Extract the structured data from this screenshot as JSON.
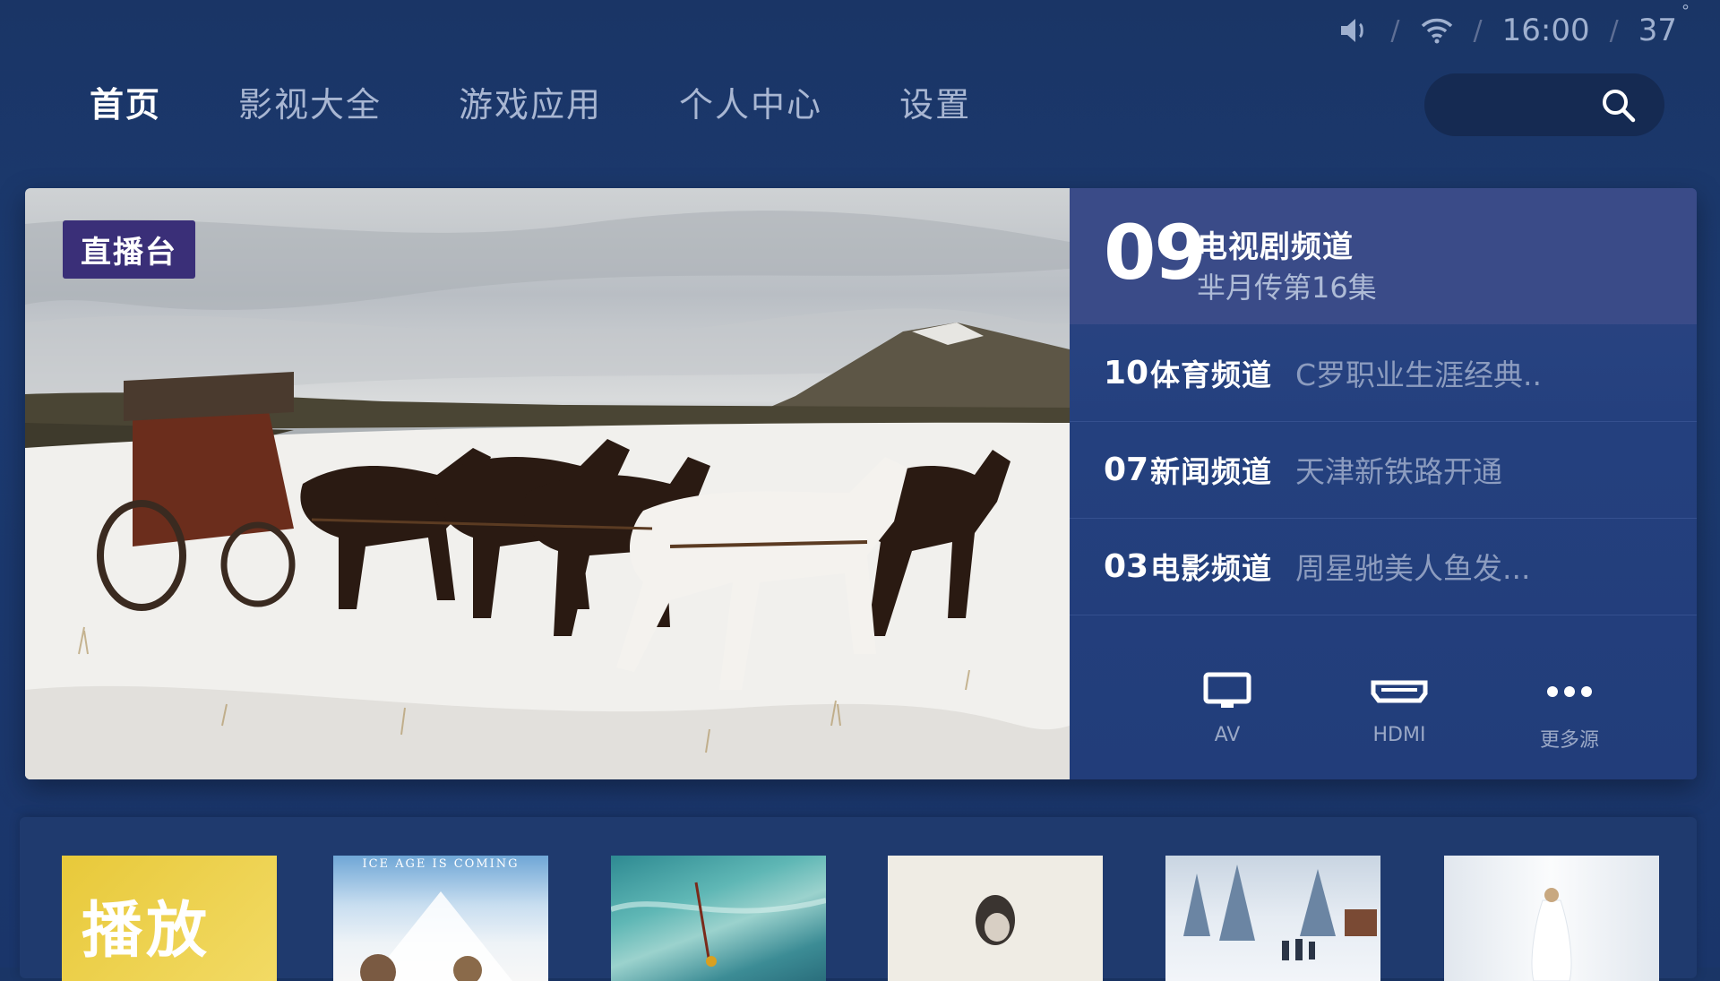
{
  "status": {
    "volume_icon": "speaker-icon",
    "wifi_icon": "wifi-icon",
    "time": "16:00",
    "temperature": "37",
    "temp_unit": "°"
  },
  "nav": {
    "tabs": [
      {
        "label": "首页",
        "active": true
      },
      {
        "label": "影视大全",
        "active": false
      },
      {
        "label": "游戏应用",
        "active": false
      },
      {
        "label": "个人中心",
        "active": false
      },
      {
        "label": "设置",
        "active": false
      }
    ],
    "search_icon": "search-icon"
  },
  "hero": {
    "badge": "直播台",
    "featured": {
      "number": "09",
      "name": "电视剧频道",
      "program": "芈月传第16集"
    },
    "channels": [
      {
        "number": "10",
        "name": "体育频道",
        "program": "C罗职业生涯经典.."
      },
      {
        "number": "07",
        "name": "新闻频道",
        "program": "天津新铁路开通"
      },
      {
        "number": "03",
        "name": "电影频道",
        "program": "周星驰美人鱼发..."
      }
    ],
    "sources": [
      {
        "label": "AV",
        "icon": "monitor-icon"
      },
      {
        "label": "HDMI",
        "icon": "hdmi-icon"
      },
      {
        "label": "更多源",
        "icon": "more-dots-icon"
      }
    ]
  },
  "bottom": {
    "poster1_text": "播放",
    "poster2_tagline": "ICE AGE IS COMING"
  },
  "colors": {
    "background": "#1a3566",
    "badge": "#3a2f78",
    "channel_panel": "#24407e",
    "featured_row": "#3a4b88"
  }
}
